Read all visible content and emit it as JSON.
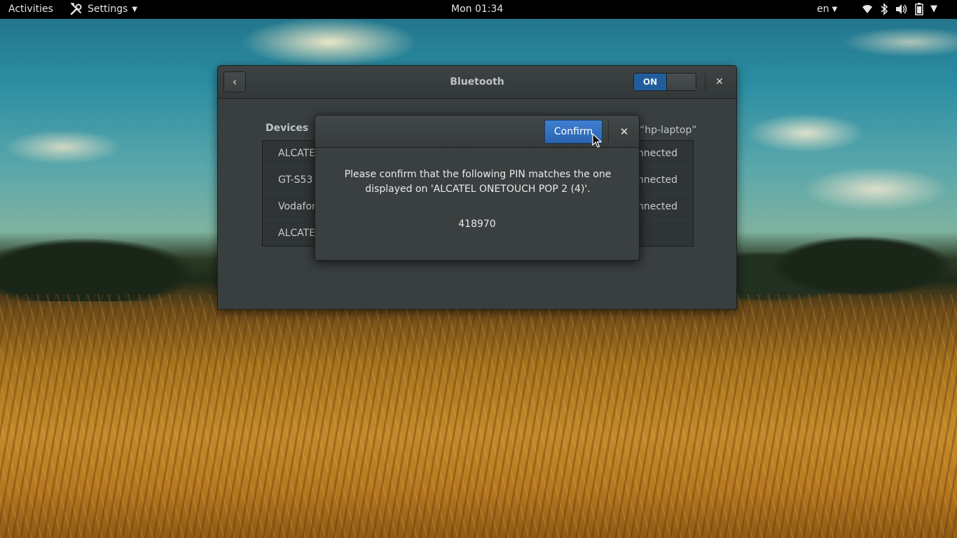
{
  "topbar": {
    "activities": "Activities",
    "app_menu": "Settings",
    "clock": "Mon 01:34",
    "language": "en",
    "status_icons": [
      "wifi-icon",
      "bluetooth-icon",
      "volume-icon",
      "battery-icon"
    ]
  },
  "window": {
    "title": "Bluetooth",
    "toggle_label": "ON",
    "toggle_state": true,
    "devices_label": "Devices",
    "host_label": "“hp-laptop”",
    "devices": [
      {
        "name": "ALCATE",
        "status": "nnected"
      },
      {
        "name": "GT-S53",
        "status": "nnected"
      },
      {
        "name": "Vodafor",
        "status": "nnected"
      },
      {
        "name": "ALCATE",
        "status": ""
      }
    ]
  },
  "dialog": {
    "confirm_label": "Confirm",
    "message": "Please confirm that the following PIN matches the one displayed on 'ALCATEL ONETOUCH POP 2 (4)'.",
    "pin": "418970"
  },
  "colors": {
    "accent": "#215d9c",
    "button_blue": "#3f7fd1",
    "window_bg": "#393f3f",
    "topbar_bg": "#000000"
  }
}
